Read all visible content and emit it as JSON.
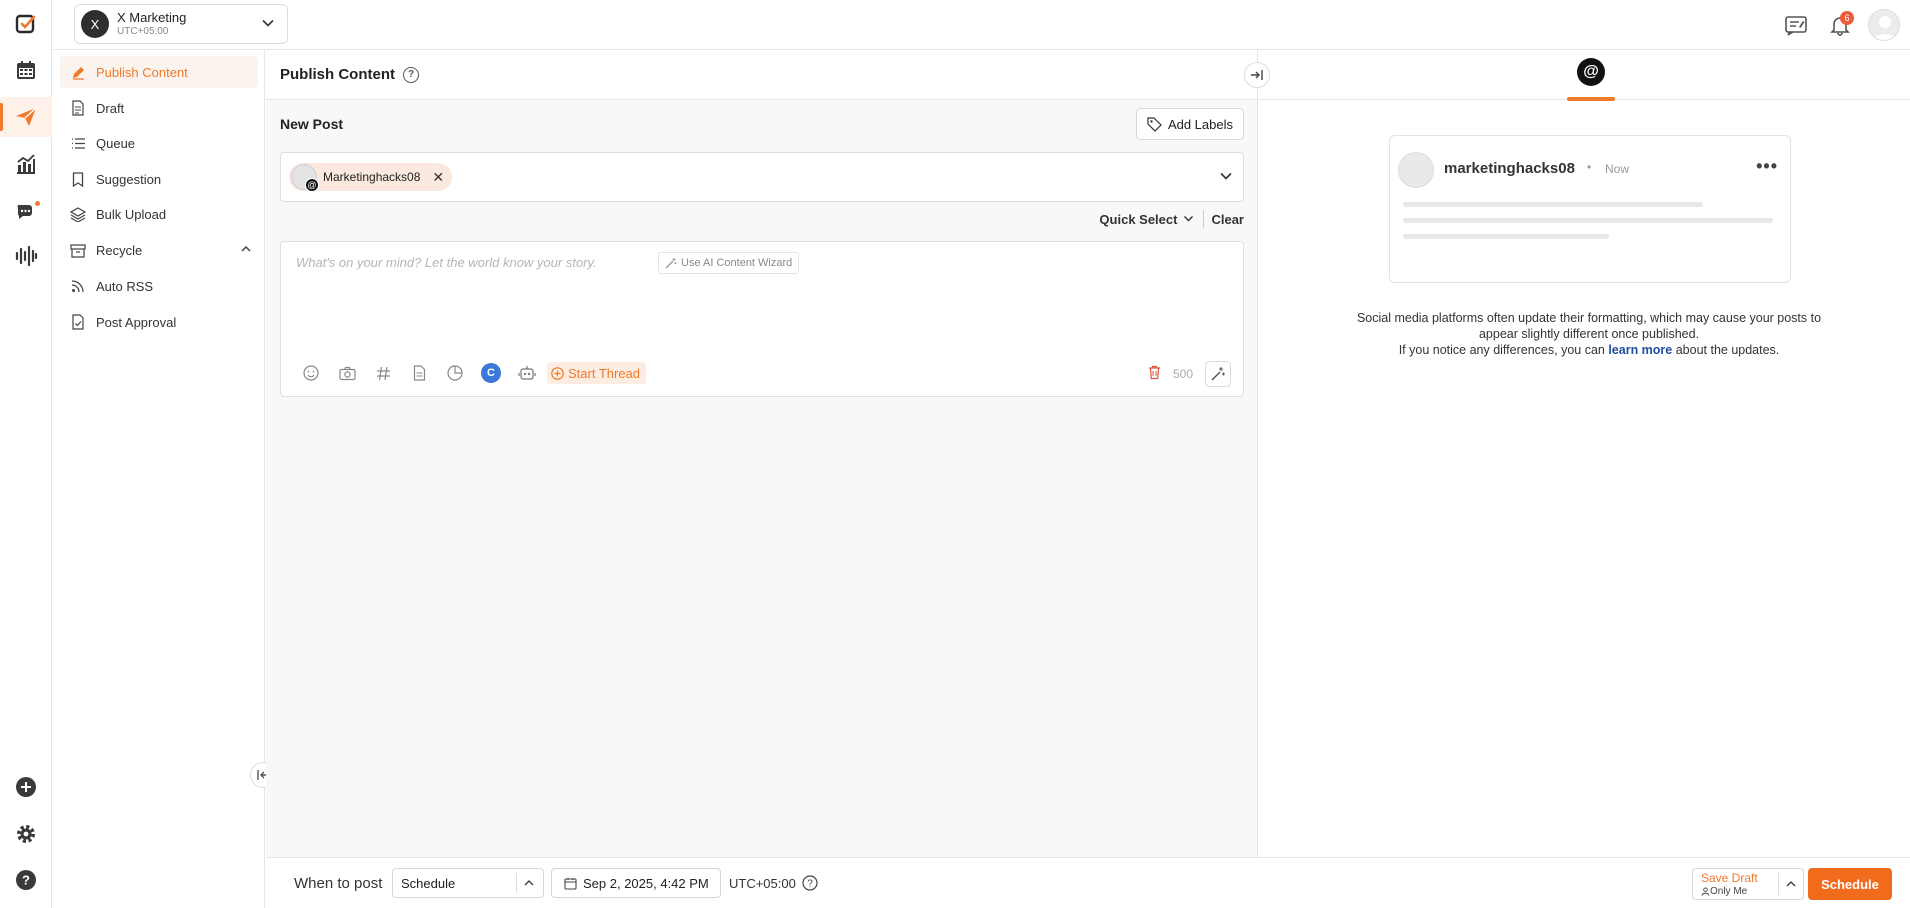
{
  "workspace": {
    "initial": "X",
    "name": "X Marketing",
    "timezone": "UTC+05:00"
  },
  "topbar": {
    "notification_count": "6"
  },
  "subnav": {
    "items": [
      {
        "label": "Publish Content",
        "icon": "pencil-icon",
        "active": true
      },
      {
        "label": "Draft",
        "icon": "document-icon"
      },
      {
        "label": "Queue",
        "icon": "list-icon"
      },
      {
        "label": "Suggestion",
        "icon": "bookmark-icon"
      },
      {
        "label": "Bulk Upload",
        "icon": "layers-icon"
      },
      {
        "label": "Recycle",
        "icon": "archive-icon",
        "expandable": true
      },
      {
        "label": "Auto RSS",
        "icon": "rss-icon"
      },
      {
        "label": "Post Approval",
        "icon": "file-check-icon"
      }
    ]
  },
  "main": {
    "title": "Publish Content",
    "new_post": "New Post",
    "add_labels": "Add Labels",
    "selected_account": "Marketinghacks08",
    "quick_select": "Quick Select",
    "clear": "Clear",
    "composer_placeholder": "What's on your mind? Let the world know your story.",
    "ai_wizard": "Use AI Content Wizard",
    "start_thread": "Start Thread",
    "char_count": "500",
    "canva_letter": "C"
  },
  "preview": {
    "username": "marketinghacks08",
    "dot": "•",
    "time": "Now",
    "more": "•••",
    "disclaimer_line1": "Social media platforms often update their formatting, which may cause your posts to appear slightly different once published.",
    "disclaimer_line2_pre": "If you notice any differences, you can ",
    "disclaimer_link": "learn more",
    "disclaimer_line2_post": " about the updates."
  },
  "bottom": {
    "when_to_post": "When to post",
    "schedule_option": "Schedule",
    "date": "Sep 2, 2025, 4:42 PM",
    "timezone": "UTC+05:00",
    "save_draft": "Save Draft",
    "visibility": "Only Me",
    "schedule_button": "Schedule"
  },
  "colors": {
    "accent": "#ef7a2b",
    "primary_button": "#f26b1d",
    "link": "#1f4e9c"
  }
}
